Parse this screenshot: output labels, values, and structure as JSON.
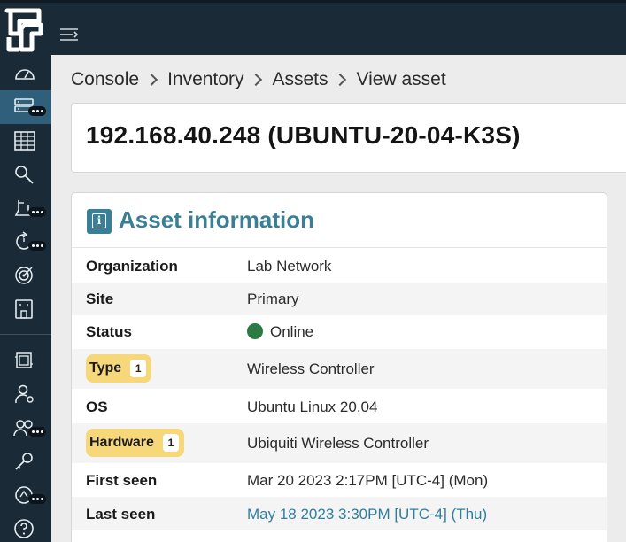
{
  "app": {
    "logo_icon": "app-logo",
    "menu_icon": "hamburger-menu-icon",
    "accent": "#3a7f96",
    "sidebar_bg": "#1a2b37",
    "active_bg": "#2f5f7b"
  },
  "sidebar": {
    "items": [
      {
        "name": "dashboard",
        "icon": "gauge-icon",
        "has_more": false,
        "active": false
      },
      {
        "name": "inventory",
        "icon": "server-list-icon",
        "has_more": true,
        "active": true
      },
      {
        "name": "reports",
        "icon": "grid-table-icon",
        "has_more": false,
        "active": false
      },
      {
        "name": "queries",
        "icon": "search-icon",
        "has_more": false,
        "active": false
      },
      {
        "name": "alerts",
        "icon": "bell-icon",
        "has_more": true,
        "active": false
      },
      {
        "name": "tasks",
        "icon": "refresh-timer-icon",
        "has_more": true,
        "active": false
      },
      {
        "name": "goals",
        "icon": "target-icon",
        "has_more": false,
        "active": false
      },
      {
        "name": "sites",
        "icon": "building-icon",
        "has_more": false,
        "active": false
      },
      {
        "name": "organizations",
        "icon": "layers-icon",
        "has_more": false,
        "active": false
      },
      {
        "name": "account",
        "icon": "user-settings-icon",
        "has_more": false,
        "active": false
      },
      {
        "name": "users",
        "icon": "users-icon",
        "has_more": true,
        "active": false
      },
      {
        "name": "api-keys",
        "icon": "key-icon",
        "has_more": false,
        "active": false
      },
      {
        "name": "integrations",
        "icon": "plug-icon",
        "has_more": true,
        "active": false
      },
      {
        "name": "help",
        "icon": "help-icon",
        "has_more": false,
        "active": false
      }
    ]
  },
  "breadcrumb": [
    "Console",
    "Inventory",
    "Assets",
    "View asset"
  ],
  "page": {
    "title": "192.168.40.248 (UBUNTU-20-04-K3S)"
  },
  "card": {
    "icon": "info-icon",
    "title": "Asset information",
    "rows": [
      {
        "label": "Organization",
        "value": "Lab Network"
      },
      {
        "label": "Site",
        "value": "Primary"
      },
      {
        "label": "Status",
        "value": "Online",
        "status_color": "#2c7a43"
      },
      {
        "label": "Type",
        "value": "Wireless Controller",
        "count": "1"
      },
      {
        "label": "OS",
        "value": "Ubuntu Linux 20.04"
      },
      {
        "label": "Hardware",
        "value": "Ubiquiti Wireless Controller",
        "count": "1"
      },
      {
        "label": "First seen",
        "value": "Mar 20 2023 2:17PM [UTC-4] (Mon)"
      },
      {
        "label": "Last seen",
        "value": "May 18 2023 3:30PM [UTC-4] (Thu)"
      }
    ]
  }
}
